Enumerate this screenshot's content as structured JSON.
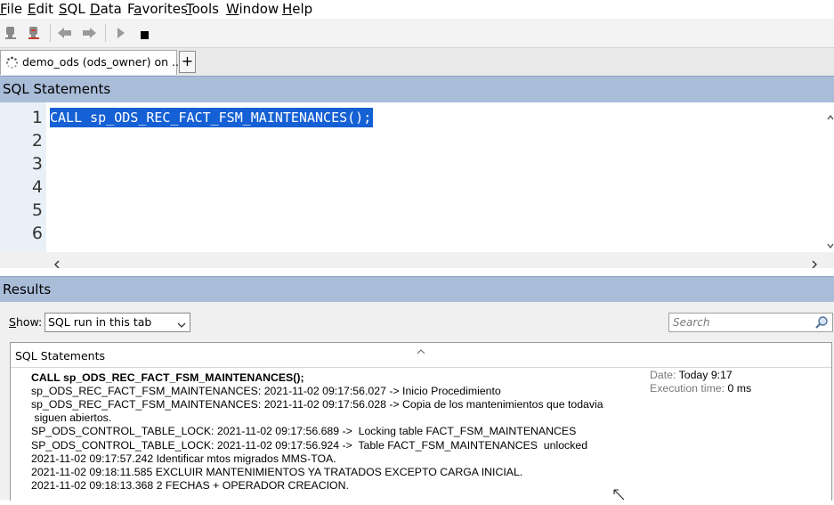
{
  "menu": {
    "items": [
      {
        "accel": "F",
        "rest": "ile"
      },
      {
        "accel": "E",
        "rest": "dit"
      },
      {
        "accel": "S",
        "rest": "QL"
      },
      {
        "accel": "D",
        "rest": "ata"
      },
      {
        "pre": "F",
        "accel": "a",
        "rest": "vorites"
      },
      {
        "accel": "T",
        "rest": "ools"
      },
      {
        "accel": "W",
        "rest": "indow"
      },
      {
        "accel": "H",
        "rest": "elp"
      }
    ]
  },
  "toolbar": {
    "icons": [
      "connect-icon",
      "disconnect-icon",
      "back-icon",
      "forward-icon",
      "run-icon",
      "stop-icon"
    ]
  },
  "tab": {
    "label": "demo_ods (ods_owner) on ...",
    "add_label": "+"
  },
  "editor": {
    "header": "SQL Statements",
    "line_numbers": [
      "1",
      "2",
      "3",
      "4",
      "5",
      "6"
    ],
    "code": "CALL sp_ODS_REC_FACT_FSM_MAINTENANCES();"
  },
  "results": {
    "header": "Results",
    "show_label": "how:",
    "show_accel": "S",
    "show_value": "SQL run in this tab",
    "search_placeholder": "Search",
    "panel_title": "SQL Statements",
    "statement": "CALL sp_ODS_REC_FACT_FSM_MAINTENANCES();",
    "log_lines": [
      "sp_ODS_REC_FACT_FSM_MAINTENANCES: 2021-11-02 09:17:56.027 -> Inicio Procedimiento",
      "sp_ODS_REC_FACT_FSM_MAINTENANCES: 2021-11-02 09:17:56.028 -> Copia de los mantenimientos que todavia",
      " siguen abiertos.",
      "SP_ODS_CONTROL_TABLE_LOCK: 2021-11-02 09:17:56.689 ->  Locking table FACT_FSM_MAINTENANCES",
      "SP_ODS_CONTROL_TABLE_LOCK: 2021-11-02 09:17:56.924 ->  Table FACT_FSM_MAINTENANCES  unlocked",
      "2021-11-02 09:17:57.242 Identificar mtos migrados MMS-TOA.",
      "2021-11-02 09:18:11.585 EXCLUIR MANTENIMIENTOS YA TRATADOS EXCEPTO CARGA INICIAL.",
      "2021-11-02 09:18:13.368 2 FECHAS + OPERADOR CREACION."
    ],
    "date_label": "Date:",
    "date_value": "Today 9:17",
    "exec_label": "Execution time:",
    "exec_value": "0 ms"
  },
  "colors": {
    "section_header": "#a9bdd9",
    "selection": "#1560d4",
    "gutter": "#e9f0f8"
  }
}
